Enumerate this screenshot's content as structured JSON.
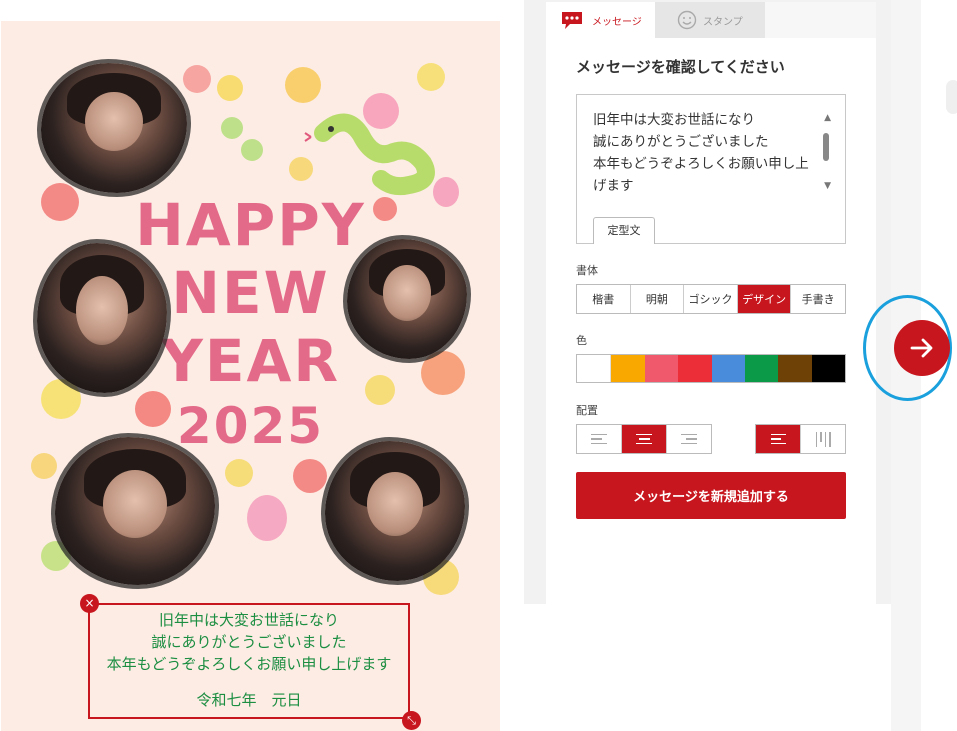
{
  "card": {
    "title_line1": "HAPPY",
    "title_line2": "NEW",
    "title_line3": "YEAR",
    "year": "2025",
    "message_lines": [
      "旧年中は大変お世話になり",
      "誠にありがとうございました",
      "本年もどうぞよろしくお願い申し上げます"
    ],
    "signature": "令和七年　元日",
    "delete_icon": "×",
    "resize_icon": "⤡"
  },
  "tabs": [
    {
      "label": "メッセージ",
      "icon": "speech-bubble-icon",
      "active": true
    },
    {
      "label": "スタンプ",
      "icon": "smiley-icon",
      "active": false
    }
  ],
  "panel": {
    "heading": "メッセージを確認してください",
    "message_text": "旧年中は大変お世話になり\n誠にありがとうございました\n本年もどうぞよろしくお願い申し上げます",
    "template_button": "定型文",
    "font_label": "書体",
    "fonts": [
      "楷書",
      "明朝",
      "ゴシック",
      "デザイン",
      "手書き"
    ],
    "selected_font": "デザイン",
    "color_label": "色",
    "colors": [
      "#ffffff",
      "#f9a800",
      "#f0586c",
      "#ec2e38",
      "#4a8cdc",
      "#0a9a48",
      "#6e4206",
      "#000000"
    ],
    "align_label": "配置",
    "alignments": [
      "left",
      "center",
      "right"
    ],
    "selected_alignment": "center",
    "orientations": [
      "horizontal",
      "vertical"
    ],
    "selected_orientation": "horizontal",
    "add_button": "メッセージを新規追加する"
  },
  "accent_color": "#c8161e",
  "highlight_color": "#1aa0dc"
}
